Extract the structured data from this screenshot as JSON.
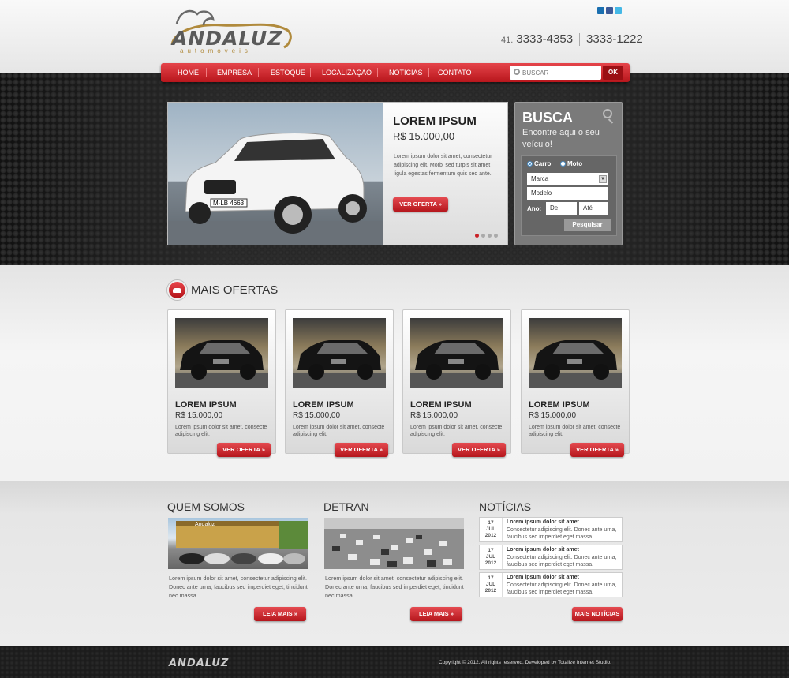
{
  "brand": {
    "name": "ANDALUZ",
    "subtitle": "automoveis"
  },
  "header": {
    "phone_prefix": "41.",
    "phone1": "3333-4353",
    "phone2": "3333-1222"
  },
  "social": [
    "linkedin-icon",
    "facebook-icon",
    "twitter-icon"
  ],
  "nav": {
    "items": [
      "HOME",
      "EMPRESA",
      "ESTOQUE",
      "LOCALIZAÇÃO",
      "NOTÍCIAS",
      "CONTATO"
    ]
  },
  "search": {
    "placeholder": "BUSCAR",
    "button": "OK"
  },
  "slide": {
    "title": "LOREM IPSUM",
    "price": "R$ 15.000,00",
    "description": "Lorem ipsum dolor sit amet, consectetur adipiscing elit. Morbi sed turpis sit amet ligula egestas fermentum quis sed ante.",
    "button": "VER OFERTA",
    "plate": "M·LB 4663",
    "slides_total": 4,
    "active_slide": 1
  },
  "busca": {
    "title": "BUSCA",
    "subtitle": "Encontre aqui o seu veículo!",
    "radio_car": "Carro",
    "radio_moto": "Moto",
    "marca": "Marca",
    "modelo": "Modelo",
    "ano_label": "Ano:",
    "ano_de": "De",
    "ano_ate": "Até",
    "button": "Pesquisar"
  },
  "offers": {
    "title": "MAIS OFERTAS",
    "cards": [
      {
        "title": "LOREM IPSUM",
        "price": "R$ 15.000,00",
        "description": "Lorem ipsum dolor sit amet, consecte adipiscing elit.",
        "button": "VER OFERTA"
      },
      {
        "title": "LOREM IPSUM",
        "price": "R$ 15.000,00",
        "description": "Lorem ipsum dolor sit amet, consecte adipiscing elit.",
        "button": "VER OFERTA"
      },
      {
        "title": "LOREM IPSUM",
        "price": "R$ 15.000,00",
        "description": "Lorem ipsum dolor sit amet, consecte adipiscing elit.",
        "button": "VER OFERTA"
      },
      {
        "title": "LOREM IPSUM",
        "price": "R$ 15.000,00",
        "description": "Lorem ipsum dolor sit amet, consecte adipiscing elit.",
        "button": "VER OFERTA"
      }
    ]
  },
  "quem_somos": {
    "title": "QUEM SOMOS",
    "sign": "Andaluz",
    "text": "Lorem ipsum dolor sit amet, consectetur adipiscing elit. Donec ante urna, faucibus sed imperdiet eget, tincidunt nec massa.",
    "button": "LEIA MAIS"
  },
  "detran": {
    "title": "DETRAN",
    "text": "Lorem ipsum dolor sit amet, consectetur adipiscing elit. Donec ante urna, faucibus sed imperdiet eget, tincidunt nec massa.",
    "button": "LEIA MAIS"
  },
  "noticias": {
    "title": "NOTÍCIAS",
    "items": [
      {
        "day": "17",
        "month": "JUL",
        "year": "2012",
        "title": "Lorem ipsum dolor sit amet",
        "text": "Consectetur adipiscing elit. Donec ante urna, faucibus sed imperdiet eget massa."
      },
      {
        "day": "17",
        "month": "JUL",
        "year": "2012",
        "title": "Lorem ipsum dolor sit amet",
        "text": "Consectetur adipiscing elit. Donec ante urna, faucibus sed imperdiet eget massa."
      },
      {
        "day": "17",
        "month": "JUL",
        "year": "2012",
        "title": "Lorem ipsum dolor sit amet",
        "text": "Consectetur adipiscing elit. Donec ante urna, faucibus sed imperdiet eget massa."
      }
    ],
    "button": "MAIS NOTÍCIAS"
  },
  "footer": {
    "logo": "ANDALUZ",
    "copyright": "Copyright © 2012. All rights reserved. Developed by Totalize Internet Studio."
  },
  "colors": {
    "accent": "#c92127",
    "dark": "#1c1c1c",
    "panel": "#7a7a7a"
  }
}
